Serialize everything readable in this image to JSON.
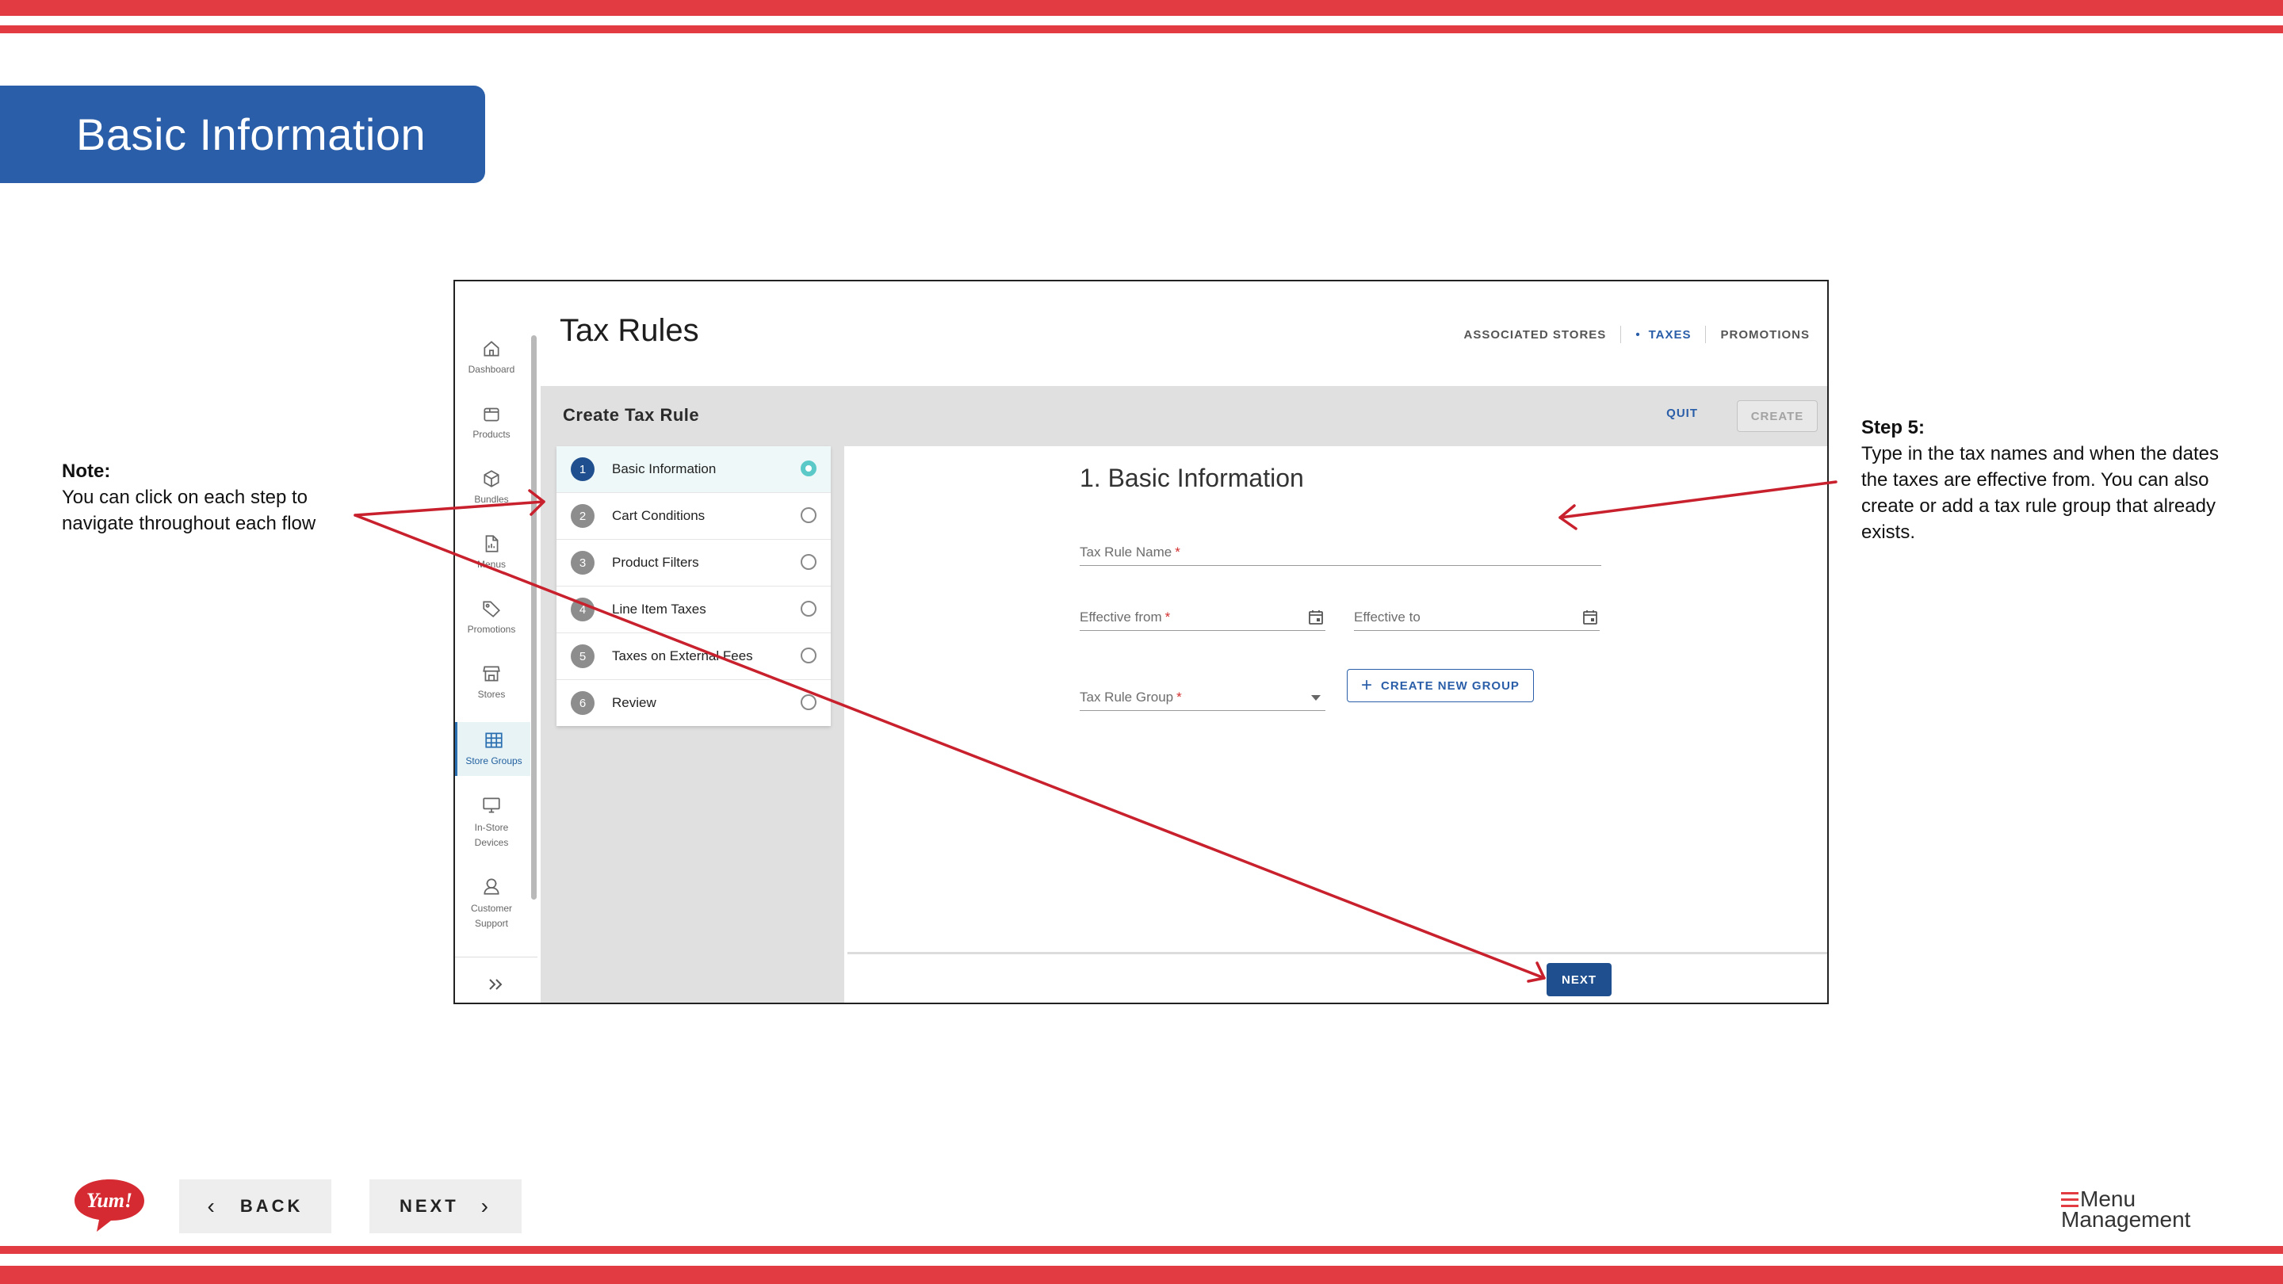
{
  "slide": {
    "title": "Basic Information",
    "note_heading": "Note:",
    "note_text": "You can click on each step to navigate throughout each flow",
    "step_heading": "Step 5:",
    "step_text": "Type in the tax names and when the dates the taxes are effective from. You can also create or add a tax rule group that already exists."
  },
  "app": {
    "page_title": "Tax Rules",
    "top_tabs": [
      {
        "label": "ASSOCIATED STORES",
        "active": false
      },
      {
        "label": "TAXES",
        "active": true
      },
      {
        "label": "PROMOTIONS",
        "active": false
      }
    ],
    "sidebar": [
      {
        "label": "Dashboard",
        "icon": "home-icon",
        "active": false
      },
      {
        "label": "Products",
        "icon": "box-icon",
        "active": false
      },
      {
        "label": "Bundles",
        "icon": "cube-icon",
        "active": false
      },
      {
        "label": "Menus",
        "icon": "document-icon",
        "active": false
      },
      {
        "label": "Promotions",
        "icon": "tag-icon",
        "active": false
      },
      {
        "label": "Stores",
        "icon": "storefront-icon",
        "active": false
      },
      {
        "label": "Store Groups",
        "icon": "grid-icon",
        "active": true
      },
      {
        "label": "In-Store Devices",
        "icon": "monitor-icon",
        "active": false
      },
      {
        "label": "Customer Support",
        "icon": "support-icon",
        "active": false
      }
    ],
    "create_bar": {
      "title": "Create Tax Rule",
      "quit": "QUIT",
      "create": "CREATE"
    },
    "steps": [
      {
        "num": "1",
        "label": "Basic Information",
        "active": true
      },
      {
        "num": "2",
        "label": "Cart Conditions",
        "active": false
      },
      {
        "num": "3",
        "label": "Product Filters",
        "active": false
      },
      {
        "num": "4",
        "label": "Line Item Taxes",
        "active": false
      },
      {
        "num": "5",
        "label": "Taxes on External Fees",
        "active": false
      },
      {
        "num": "6",
        "label": "Review",
        "active": false
      }
    ],
    "form": {
      "title": "1. Basic Information",
      "tax_rule_name": "Tax Rule Name",
      "effective_from": "Effective from",
      "effective_to": "Effective to",
      "tax_rule_group": "Tax Rule Group",
      "required_mark": "*",
      "new_group": "CREATE NEW GROUP",
      "next": "NEXT"
    }
  },
  "footer": {
    "back": "BACK",
    "next": "NEXT",
    "logo_text": "Yum!",
    "brand_line1": "Menu",
    "brand_line2": "Management"
  },
  "colors": {
    "stripe": "#e33b42",
    "banner": "#2a5ea8",
    "primary": "#1f4f8e",
    "teal": "#5cc9c9"
  }
}
